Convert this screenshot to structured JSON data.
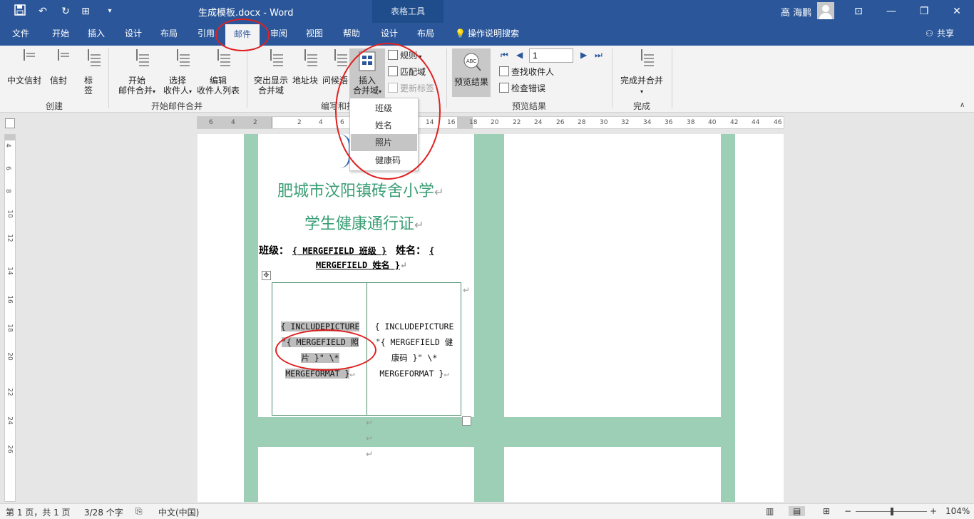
{
  "titlebar": {
    "doc_title": "生成模板.docx  -  Word",
    "context_label": "表格工具",
    "user": "高 海鹏",
    "minimize": "—",
    "restore": "❐",
    "close": "✕",
    "ribbon_toggle": "⊡"
  },
  "tabs": [
    {
      "label": "文件"
    },
    {
      "label": "开始"
    },
    {
      "label": "插入"
    },
    {
      "label": "设计"
    },
    {
      "label": "布局"
    },
    {
      "label": "引用"
    },
    {
      "label": "邮件"
    },
    {
      "label": "审阅"
    },
    {
      "label": "视图"
    },
    {
      "label": "帮助"
    },
    {
      "label": "设计"
    },
    {
      "label": "布局"
    }
  ],
  "search_tab": "操作说明搜索",
  "share": "共享",
  "ribbon": {
    "create": {
      "label": "创建",
      "cn_envelope": "中文信封",
      "envelope": "信封",
      "labels": "标签"
    },
    "start_merge": {
      "label": "开始邮件合并",
      "start_l1": "开始",
      "start_l2": "邮件合并",
      "select_l1": "选择",
      "select_l2": "收件人",
      "edit_l1": "编辑",
      "edit_l2": "收件人列表"
    },
    "write_insert": {
      "label": "编写和插",
      "highlight_l1": "突出显示",
      "highlight_l2": "合并域",
      "address": "地址块",
      "greeting": "问候语",
      "insert_l1": "插入",
      "insert_l2": "合并域",
      "rules": "规则",
      "match": "匹配域",
      "update": "更新标签"
    },
    "preview": {
      "label": "预览结果",
      "preview_btn": "预览结果",
      "record": "1",
      "find": "查找收件人",
      "check": "检查错误"
    },
    "finish": {
      "label": "完成",
      "finish_btn": "完成并合并"
    }
  },
  "dropdown": {
    "items": [
      "班级",
      "姓名",
      "照片",
      "健康码"
    ],
    "highlighted_index": 2
  },
  "rulers": {
    "h_numbers": [
      "6",
      "4",
      "2",
      "2",
      "4",
      "6",
      "14",
      "16",
      "18",
      "20",
      "22",
      "24",
      "26",
      "28",
      "30",
      "32",
      "34",
      "36",
      "38",
      "40",
      "42",
      "44",
      "46"
    ],
    "v_numbers": [
      "4",
      "6",
      "8",
      "10",
      "12",
      "14",
      "16",
      "18",
      "20",
      "22",
      "24",
      "26"
    ]
  },
  "document": {
    "school_line1": "肥城市汶阳镇砖舍小学",
    "school_line2": "学生健康通行证",
    "para_mark": "↵",
    "class_label": "班级：",
    "class_field": "{ MERGEFIELD 班级 }",
    "name_label": "姓名：",
    "name_field_start": "{",
    "name_field_end": "MERGEFIELD 姓名 }",
    "cell_left": [
      "{ INCLUDEPICTURE",
      "\"{ MERGEFIELD 照",
      "片 }\"  \\*",
      "MERGEFORMAT }"
    ],
    "cell_right": [
      "{ INCLUDEPICTURE",
      "\"{ MERGEFIELD 健",
      "康码 }\"  \\*",
      "MERGEFORMAT }"
    ]
  },
  "status": {
    "page": "第 1 页，共 1 页",
    "words": "3/28 个字",
    "lang": "中文(中国)",
    "zoom": "104%",
    "zoom_level_percent": 104
  },
  "colors": {
    "accent": "#2b579a",
    "green_band": "#9ccfb5",
    "school_text": "#3a9e74",
    "annotation": "#e02020"
  }
}
